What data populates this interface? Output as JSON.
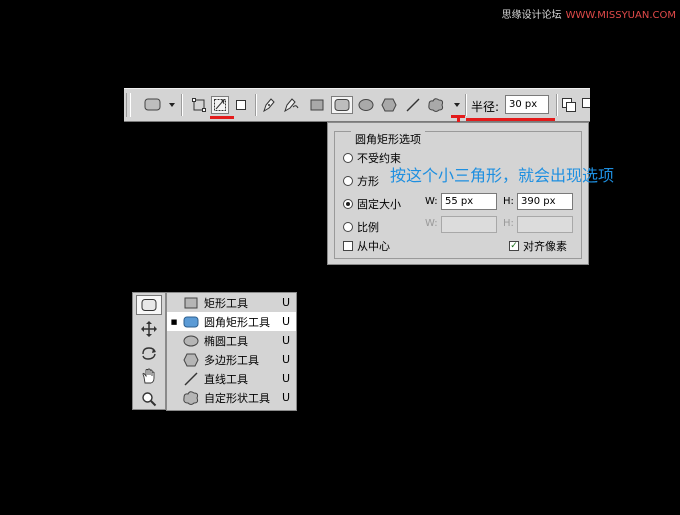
{
  "watermark": {
    "site_cn": "思缘设计论坛",
    "site_url": "WWW.MISSYUAN.COM"
  },
  "toolbar": {
    "radius_label": "半径:",
    "radius_value": "30 px"
  },
  "popup": {
    "title": "圆角矩形选项",
    "options": [
      {
        "label": "不受约束",
        "selected": false
      },
      {
        "label": "方形",
        "selected": false
      },
      {
        "label": "固定大小",
        "selected": true
      },
      {
        "label": "比例",
        "selected": false
      }
    ],
    "fixed_w_label": "W:",
    "fixed_w_value": "55 px",
    "fixed_h_label": "H:",
    "fixed_h_value": "390 px",
    "ratio_w_label": "W:",
    "ratio_h_label": "H:",
    "from_center_label": "从中心",
    "from_center_checked": false,
    "snap_pixels_label": "对齐像素",
    "snap_pixels_checked": true,
    "check_mark": "✓"
  },
  "annotation": {
    "text": "按这个小三角形，就会出现选项",
    "color": "#1e8fe0"
  },
  "accent_red": "#e31b1b",
  "flyout": {
    "items": [
      {
        "label": "矩形工具",
        "key": "U",
        "icon": "rectangle-icon",
        "selected": false
      },
      {
        "label": "圆角矩形工具",
        "key": "U",
        "icon": "rounded-rectangle-icon",
        "selected": true,
        "bullet": "■"
      },
      {
        "label": "椭圆工具",
        "key": "U",
        "icon": "ellipse-icon",
        "selected": false
      },
      {
        "label": "多边形工具",
        "key": "U",
        "icon": "polygon-icon",
        "selected": false
      },
      {
        "label": "直线工具",
        "key": "U",
        "icon": "line-icon",
        "selected": false
      },
      {
        "label": "自定形状工具",
        "key": "U",
        "icon": "custom-shape-icon",
        "selected": false
      }
    ]
  }
}
